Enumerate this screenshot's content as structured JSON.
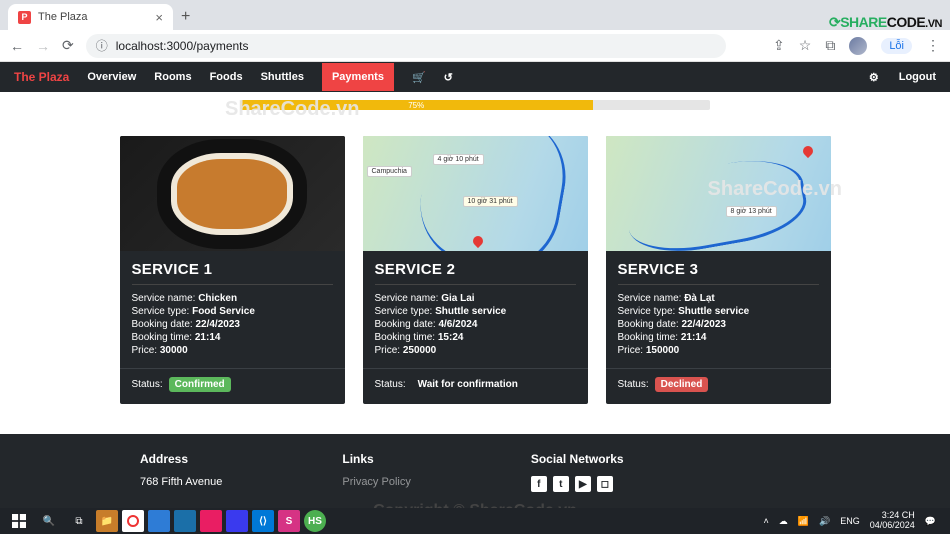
{
  "window": {
    "minimize": "—",
    "maximize": "▢",
    "close": "✕"
  },
  "browser": {
    "tab_title": "The Plaza",
    "favicon_letter": "P",
    "newtab": "+",
    "tab_close": "×",
    "url": "localhost:3000/payments",
    "loi_label": "Lỗi",
    "menu_dots": "⋮"
  },
  "sharecode": {
    "logo_a": "SHARE",
    "logo_b": "CODE",
    "logo_vn": ".VN"
  },
  "nav": {
    "brand": "The Plaza",
    "items": [
      "Overview",
      "Rooms",
      "Foods",
      "Shuttles",
      "Payments"
    ],
    "logout": "Logout"
  },
  "progress": {
    "percent": "75%"
  },
  "watermark": "ShareCode.vn",
  "copyright": "Copyright © ShareCode.vn",
  "cards": [
    {
      "title": "SERVICE 1",
      "name_label": "Service name:",
      "name": "Chicken",
      "type_label": "Service type:",
      "type": "Food Service",
      "bdate_label": "Booking date:",
      "bdate": "22/4/2023",
      "btime_label": "Booking time:",
      "btime": "21:14",
      "price_label": "Price:",
      "price": "30000",
      "status_label": "Status:",
      "status": "Confirmed",
      "status_cls": "green"
    },
    {
      "title": "SERVICE 2",
      "name_label": "Service name:",
      "name": "Gia Lai",
      "type_label": "Service type:",
      "type": "Shuttle service",
      "bdate_label": "Booking date:",
      "bdate": "4/6/2024",
      "btime_label": "Booking time:",
      "btime": "15:24",
      "price_label": "Price:",
      "price": "250000",
      "status_label": "Status:",
      "status": "Wait for confirmation",
      "status_cls": "none",
      "map_region": "Campuchia",
      "map_d1": "4 giờ 10 phút",
      "map_d2": "10 giờ 31 phút"
    },
    {
      "title": "SERVICE 3",
      "name_label": "Service name:",
      "name": "Đà Lạt",
      "type_label": "Service type:",
      "type": "Shuttle service",
      "bdate_label": "Booking date:",
      "bdate": "22/4/2023",
      "btime_label": "Booking time:",
      "btime": "21:14",
      "price_label": "Price:",
      "price": "150000",
      "status_label": "Status:",
      "status": "Declined",
      "status_cls": "red",
      "map_d1": "8 giờ 13 phút"
    }
  ],
  "footer": {
    "address_h": "Address",
    "address_1": "768 Fifth Avenue",
    "links_h": "Links",
    "links_1": "Privacy Policy",
    "social_h": "Social Networks"
  },
  "taskbar": {
    "tray": {
      "chevron": "˄",
      "lang": "ENG",
      "time": "3:24 CH",
      "date": "04/06/2024",
      "notif": "💬"
    }
  }
}
